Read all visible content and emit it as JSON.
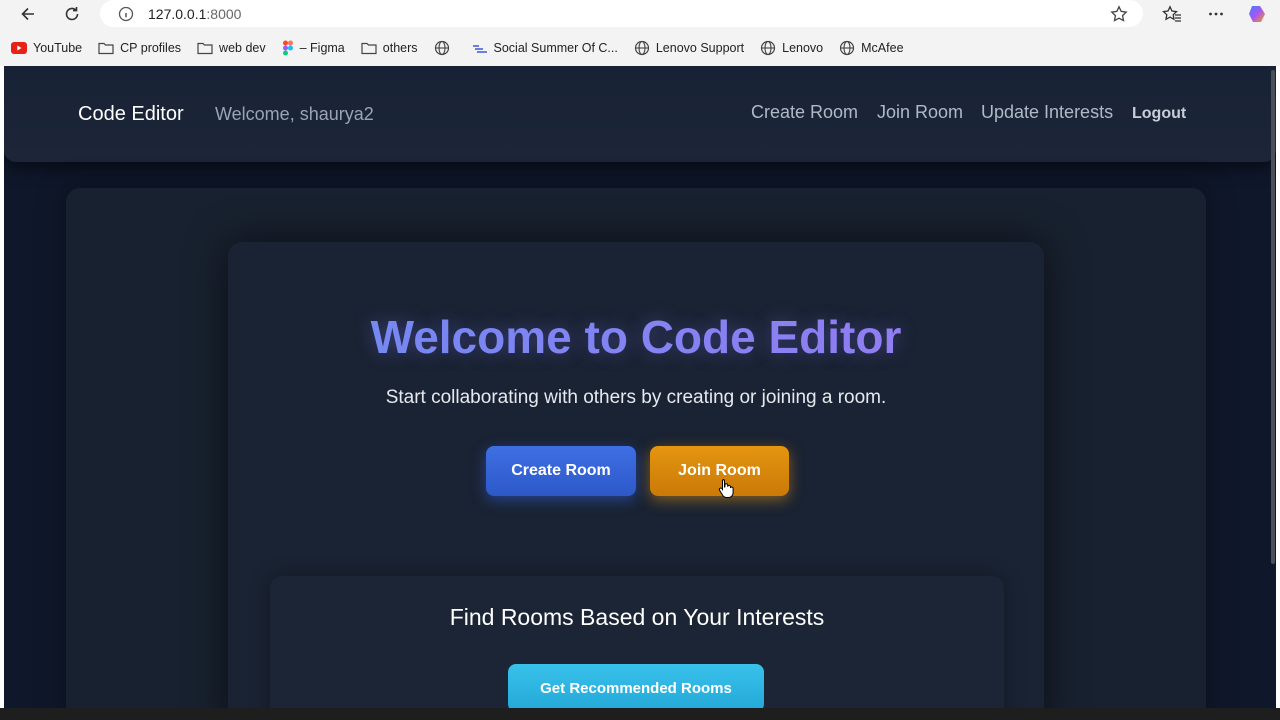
{
  "browser": {
    "url_host": "127.0.0.1",
    "url_port": ":8000",
    "bookmarks": [
      {
        "label": "YouTube",
        "icon": "youtube-icon"
      },
      {
        "label": "CP profiles",
        "icon": "folder-icon"
      },
      {
        "label": "web dev",
        "icon": "folder-icon"
      },
      {
        "label": "– Figma",
        "icon": "figma-icon"
      },
      {
        "label": "others",
        "icon": "folder-icon"
      },
      {
        "label": "",
        "icon": "globe-icon"
      },
      {
        "label": "Social Summer Of C...",
        "icon": "ssoc-icon"
      },
      {
        "label": "Lenovo Support",
        "icon": "globe-icon"
      },
      {
        "label": "Lenovo",
        "icon": "globe-icon"
      },
      {
        "label": "McAfee",
        "icon": "globe-icon"
      }
    ]
  },
  "navbar": {
    "brand": "Code Editor",
    "welcome": "Welcome, shaurya2",
    "links": {
      "create_room": "Create Room",
      "join_room": "Join Room",
      "update_interests": "Update Interests",
      "logout": "Logout"
    }
  },
  "hero": {
    "title": "Welcome to Code Editor",
    "subtitle": "Start collaborating with others by creating or joining a room.",
    "create_button": "Create Room",
    "join_button": "Join Room"
  },
  "interests": {
    "title": "Find Rooms Based on Your Interests",
    "button": "Get Recommended Rooms"
  },
  "colors": {
    "page_bg": "#0f172a",
    "create_btn": "#3e6fe3",
    "join_btn": "#e5950f",
    "recommend_btn": "#38c1ea"
  }
}
